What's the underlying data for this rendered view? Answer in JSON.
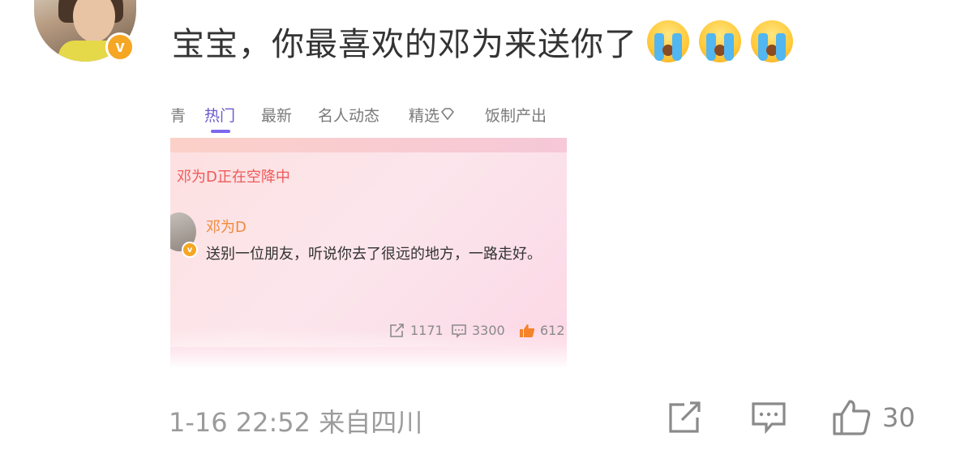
{
  "comment": {
    "text": "宝宝，你最喜欢的邓为来送你了",
    "emojis": [
      "crying-face",
      "crying-face",
      "crying-face"
    ]
  },
  "embedded_screenshot": {
    "tabs": [
      {
        "label": "青",
        "active": false
      },
      {
        "label": "热门",
        "active": true
      },
      {
        "label": "最新",
        "active": false
      },
      {
        "label": "名人动态",
        "active": false
      },
      {
        "label": "精选",
        "active": false
      },
      {
        "label": "饭制产出",
        "active": false
      }
    ],
    "card_header": "邓为D正在空降中",
    "author": "邓为D",
    "post_text": "送别一位朋友，听说你去了很远的地方，一路走好。",
    "stats": {
      "reposts": "1171",
      "comments": "3300",
      "likes": "612"
    }
  },
  "footer": {
    "timestamp": "1-16 22:52 来自四川",
    "like_count": "30"
  },
  "colors": {
    "accent_tab": "#6a5acd",
    "card_header": "#ee5a5a",
    "author": "#f08a3c",
    "like_icon": "#f5832a"
  }
}
